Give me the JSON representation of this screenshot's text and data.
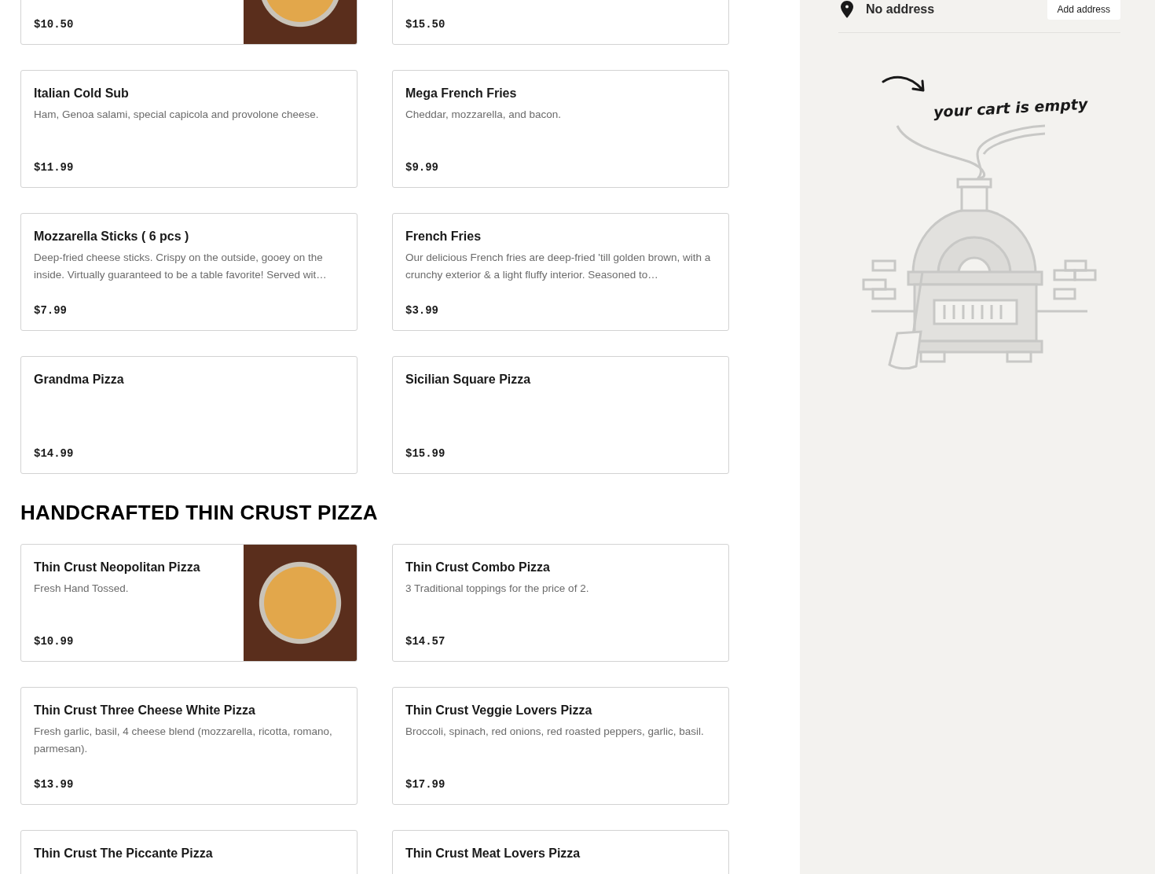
{
  "sections": [
    {
      "items": [
        {
          "price": "$10.50",
          "photo": true
        },
        {
          "price": "$15.50",
          "photo": false
        },
        {
          "name": "Italian Cold Sub",
          "description": "Ham, Genoa salami, special capicola and provolone cheese.",
          "price": "$11.99",
          "photo": false
        },
        {
          "name": "Mega French Fries",
          "description": "Cheddar, mozzarella, and bacon.",
          "price": "$9.99",
          "photo": false
        },
        {
          "name": "Mozzarella Sticks ( 6 pcs )",
          "description": "Deep-fried cheese sticks. Crispy on the outside, gooey on the inside. Virtually guaranteed to be a table favorite! Served wit…",
          "price": "$7.99",
          "photo": false
        },
        {
          "name": "French Fries",
          "description": "Our delicious French fries are deep-fried 'till golden brown, with a crunchy exterior & a light fluffy interior. Seasoned to…",
          "price": "$3.99",
          "photo": false
        },
        {
          "name": "Grandma Pizza",
          "price": "$14.99",
          "photo": false
        },
        {
          "name": "Sicilian Square Pizza",
          "price": "$15.99",
          "photo": false
        }
      ]
    },
    {
      "heading": "HANDCRAFTED THIN CRUST PIZZA",
      "items": [
        {
          "name": "Thin Crust Neopolitan Pizza",
          "description": "Fresh Hand Tossed.",
          "price": "$10.99",
          "photo": true
        },
        {
          "name": "Thin Crust Combo Pizza",
          "description": "3 Traditional toppings for the price of 2.",
          "price": "$14.57",
          "photo": false
        },
        {
          "name": "Thin Crust Three Cheese White Pizza",
          "description": "Fresh garlic, basil, 4 cheese blend (mozzarella, ricotta, romano, parmesan).",
          "price": "$13.99",
          "photo": false
        },
        {
          "name": "Thin Crust Veggie Lovers Pizza",
          "description": "Broccoli, spinach, red onions, red roasted peppers, garlic, basil.",
          "price": "$17.99",
          "photo": false
        },
        {
          "name": "Thin Crust The Piccante Pizza",
          "photo": false
        },
        {
          "name": "Thin Crust Meat Lovers Pizza",
          "photo": false
        }
      ]
    }
  ],
  "cart": {
    "address": "No address",
    "add_address_button": "Add address",
    "empty_message": "your cart is empty"
  }
}
